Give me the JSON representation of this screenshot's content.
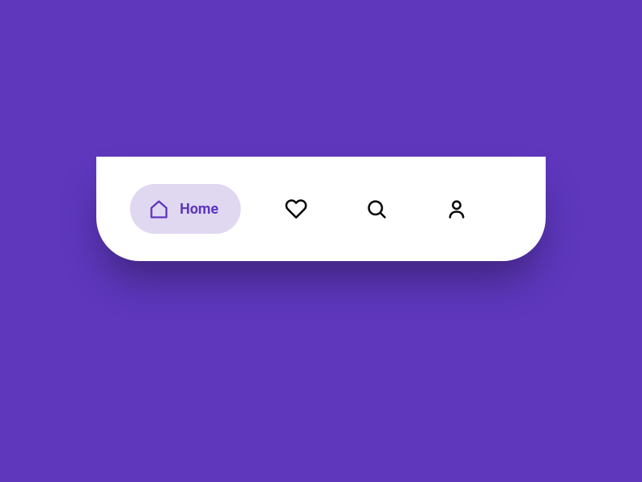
{
  "colors": {
    "background": "#5e37bd",
    "navBg": "#ffffff",
    "activePill": "#e0d7f1",
    "accent": "#5e37bd",
    "iconInactive": "#0a0a0a"
  },
  "nav": {
    "items": [
      {
        "id": "home",
        "label": "Home",
        "icon": "home-icon",
        "active": true
      },
      {
        "id": "likes",
        "label": "Likes",
        "icon": "heart-icon",
        "active": false
      },
      {
        "id": "search",
        "label": "Search",
        "icon": "search-icon",
        "active": false
      },
      {
        "id": "profile",
        "label": "Profile",
        "icon": "user-icon",
        "active": false
      }
    ]
  }
}
